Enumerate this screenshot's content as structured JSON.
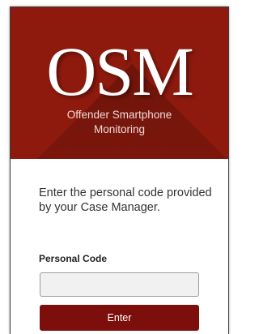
{
  "header": {
    "logo_text": "OSM",
    "subtitle_line1": "Offender Smartphone",
    "subtitle_line2": "Monitoring"
  },
  "login": {
    "instructions": "Enter the personal code provided by your Case Manager.",
    "field_label": "Personal Code",
    "code_value": "",
    "code_placeholder": "",
    "submit_label": "Enter"
  },
  "colors": {
    "brand_red": "#8e1a0e",
    "button_red": "#7c0f0c"
  }
}
